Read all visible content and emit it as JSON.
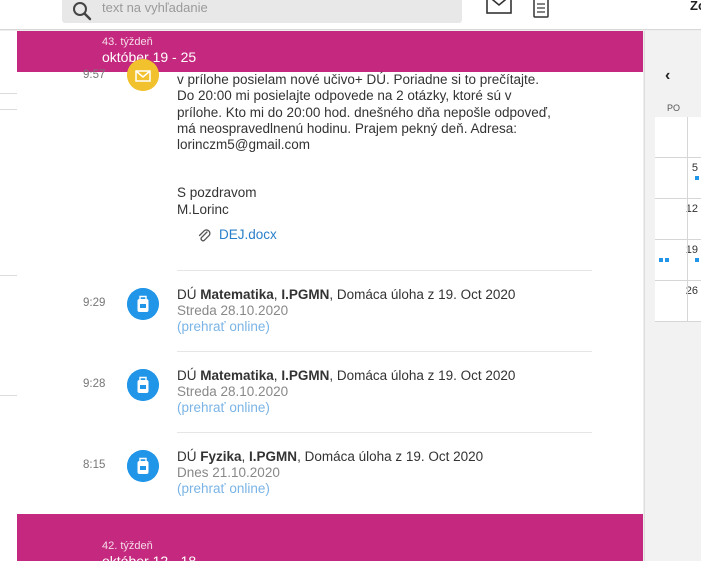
{
  "search": {
    "placeholder": "text na vyhľadanie"
  },
  "header": {
    "user_initials": "Zo"
  },
  "weeks": [
    {
      "label": "43. týždeň",
      "range": "október 19 - 25"
    },
    {
      "label": "42. týždeň",
      "range": "október 12 - 18"
    }
  ],
  "message": {
    "time": "9:57",
    "body_lines": [
      "v prílohe posielam nové učivo+ DÚ. Poriadne si to prečítajte.",
      "Do 20:00 mi posielajte odpovede na 2 otázky, ktoré sú v",
      "prílohe. Kto mi do 20:00 hod. dnešného dňa nepošle odpoveď,",
      "má neospravedlnenú hodinu. Prajem pekný deň. Adresa:",
      "lorinczm5@gmail.com"
    ],
    "greeting": "S pozdravom",
    "signature": "M.Lorinc",
    "attachment": "DEJ.docx"
  },
  "homework": [
    {
      "time": "9:29",
      "prefix": "DÚ ",
      "subject": "Matematika",
      "sep": ", ",
      "class": "I.PGMN",
      "suffix": ", Domáca úloha z 19. Oct 2020",
      "due": "Streda 28.10.2020",
      "link": "(prehrať online)"
    },
    {
      "time": "9:28",
      "prefix": "DÚ ",
      "subject": "Matematika",
      "sep": ", ",
      "class": "I.PGMN",
      "suffix": ", Domáca úloha z 19. Oct 2020",
      "due": "Streda 28.10.2020",
      "link": "(prehrať online)"
    },
    {
      "time": "8:15",
      "prefix": "DÚ ",
      "subject": "Fyzika",
      "sep": ", ",
      "class": "I.PGMN",
      "suffix": ", Domáca úloha z 19. Oct 2020",
      "due": "Dnes 21.10.2020",
      "link": "(prehrať online)"
    }
  ],
  "calendar": {
    "prev_label": "‹",
    "day_label": "PO",
    "days": [
      "",
      "5",
      "12",
      "19",
      "26"
    ]
  },
  "colors": {
    "accent": "#c5297f",
    "homework_icon": "#2196e8",
    "message_icon": "#f2c12e",
    "link": "#2a7fc9"
  },
  "icons": {
    "search": "search-icon",
    "mail": "mail-icon",
    "tasks": "clipboard-icon",
    "attachment": "paperclip-icon",
    "homework": "backpack-icon",
    "message": "envelope-icon"
  }
}
